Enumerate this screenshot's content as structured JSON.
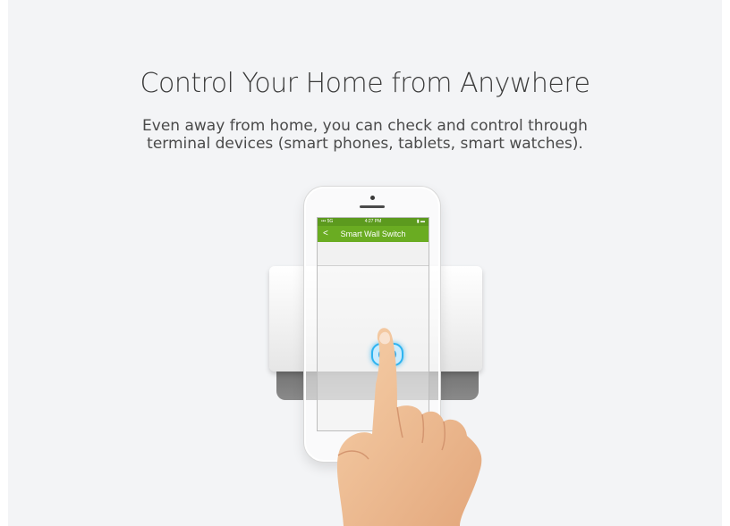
{
  "headline": "Control Your Home from Anywhere",
  "subtext": {
    "line1": "Even away from home, you can check and control through",
    "line2": "terminal devices (smart phones, tablets, smart watches)."
  },
  "phone_screen": {
    "status_left": "••• 5G",
    "status_time": "4:27 PM",
    "status_right": "▮ ▬",
    "back_glyph": "<",
    "app_title": "Smart Wall Switch"
  },
  "colors": {
    "background": "#f3f4f6",
    "app_green": "#6aac22",
    "switch_glow": "#2fb4f0"
  },
  "icons": [
    "phone-camera-icon",
    "back-arrow-icon",
    "touch-button-icon",
    "hand-icon"
  ]
}
